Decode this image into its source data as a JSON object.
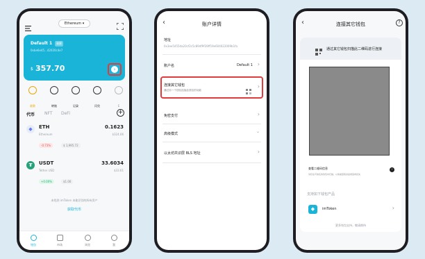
{
  "phone1": {
    "network": "Ethereum",
    "wallet_name": "Default 1",
    "wallet_tag": "观察",
    "wallet_address": "0xbe6e45...42020c4e7",
    "balance_symbol": "$",
    "balance": "357.70",
    "actions": [
      {
        "label": "收款",
        "icon": "receive-icon"
      },
      {
        "label": "转账",
        "icon": "transfer-icon"
      },
      {
        "label": "记录",
        "icon": "history-icon"
      },
      {
        "label": "闪兑",
        "icon": "swap-icon"
      },
      {
        "label": "E",
        "icon": "more-icon"
      }
    ],
    "tabs": [
      "代币",
      "NFT",
      "DeFi"
    ],
    "tokens": [
      {
        "symbol": "ETH",
        "name": "Ethereum",
        "amount": "0.1623",
        "value": "$324.06",
        "change": "-0.73%",
        "price": "$ 1,995.72"
      },
      {
        "symbol": "USDT",
        "name": "Tether USD",
        "amount": "33.6034",
        "value": "$33.61",
        "change": "+0.00%",
        "price": "$1.00"
      }
    ],
    "hint": "未找到 imToken 未能识别的所有资产",
    "get_token": "获取代币",
    "nav": [
      "钱包",
      "市场",
      "浏览",
      "我"
    ]
  },
  "phone2": {
    "title": "账户详情",
    "address_label": "地址",
    "address": "0x3ee5455da20cf2c5c89df9f39ff19e604022009b1fa",
    "account_name_label": "账户名",
    "account_name": "Default 1",
    "connect_label": "连接其它钱包",
    "connect_sub": "通过另一个钱包连接此钱包的功能",
    "free_pay": "免密支付",
    "advanced": "高级模式",
    "bls": "以太坊共识层 BLS 地址"
  },
  "phone3": {
    "title": "连接其它钱包",
    "instruction": "通过其它钱包扫描此二维码进行连接",
    "view_qr": "查看二维码信息",
    "view_qr_sub": "请仅在可信任的钱包中扫描，以免被盗取资金或造成损失",
    "supported_label": "支持如下钱包产品",
    "wallet": "imToken",
    "more": "更多钱包支持，敬请期待"
  },
  "colors": {
    "accent": "#1ab4d9",
    "highlight": "#e23b3b",
    "up": "#22b573",
    "down": "#e55b5b"
  }
}
